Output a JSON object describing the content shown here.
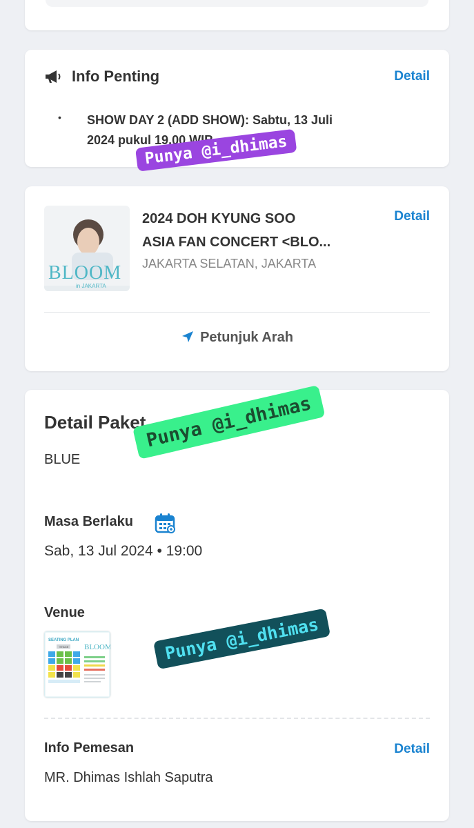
{
  "info": {
    "title": "Info Penting",
    "detail_label": "Detail",
    "bullet": "•",
    "line1": "SHOW DAY 2 (ADD SHOW): Sabtu, 13 Juli",
    "line2": "2024 pukul 19.00 WIB"
  },
  "event": {
    "poster_text": "BLOOM",
    "poster_sub": "in JAKARTA",
    "title_line1": "2024 DOH KYUNG SOO",
    "title_line2": "ASIA FAN CONCERT <BLO...",
    "location": "JAKARTA SELATAN, JAKARTA",
    "detail_label": "Detail",
    "directions_label": "Petunjuk Arah"
  },
  "package": {
    "title": "Detail Paket",
    "name": "BLUE",
    "validity_label": "Masa Berlaku",
    "validity_value": "Sab, 13 Jul 2024 • 19:00",
    "venue_label": "Venue",
    "seating_plan_title": "SEATING PLAN",
    "seating_stage": "STAGE",
    "orderer_label": "Info Pemesan",
    "orderer_detail_label": "Detail",
    "orderer_name": "MR. Dhimas Ishlah Saputra"
  },
  "watermarks": [
    "Punya @i_dhimas",
    "Punya @i_dhimas",
    "Punya @i_dhimas"
  ],
  "colors": {
    "link": "#1a83d0",
    "background": "#eef0f4",
    "watermark_purple": "#9a45e0",
    "watermark_green": "#39f08c",
    "watermark_teal": "#12505a"
  }
}
